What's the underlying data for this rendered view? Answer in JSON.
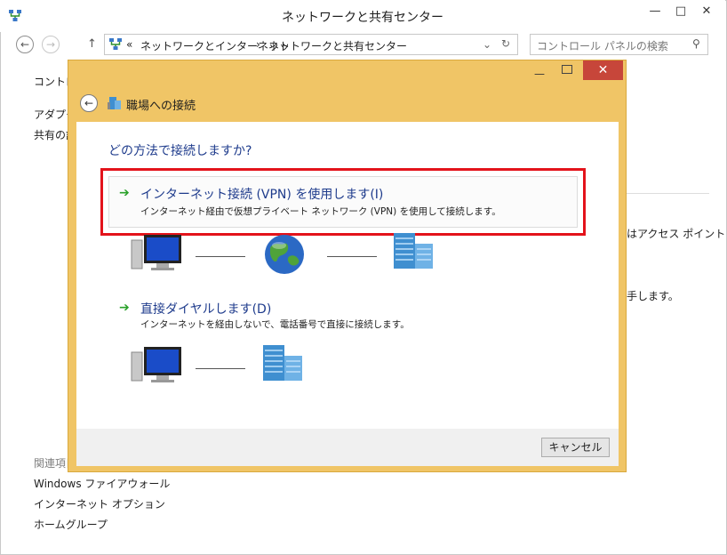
{
  "window": {
    "title": "ネットワークと共有センター",
    "address_segments": [
      "«",
      "ネットワークとインターネット",
      "›",
      "ネットワークと共有センター"
    ],
    "search_placeholder": "コントロール パネルの検索"
  },
  "background": {
    "partial_texts": [
      "コントロー",
      "アダプター",
      "共有の詳",
      "はアクセス ポイント",
      "手します。"
    ],
    "related_heading": "関連項目",
    "related_links": [
      "Windows ファイアウォール",
      "インターネット オプション",
      "ホームグループ"
    ]
  },
  "dialog": {
    "title": "職場への接続",
    "question": "どの方法で接続しますか?",
    "options": [
      {
        "title": "インターネット接続 (VPN) を使用します(I)",
        "description": "インターネット経由で仮想プライベート ネットワーク (VPN) を使用して接続します。"
      },
      {
        "title": "直接ダイヤルします(D)",
        "description": "インターネットを経由しないで、電話番号で直接に接続します。"
      }
    ],
    "cancel_label": "キャンセル"
  },
  "icons": [
    "network-icon",
    "back-arrow-icon",
    "forward-arrow-icon",
    "up-arrow-icon",
    "refresh-icon",
    "search-icon",
    "computer-icon",
    "globe-icon",
    "building-icon",
    "green-arrow-icon"
  ],
  "colors": {
    "dialog_frame": "#f0c566",
    "close_button": "#c7463a",
    "highlight": "#e3131b",
    "link_blue": "#1e3b8c"
  }
}
